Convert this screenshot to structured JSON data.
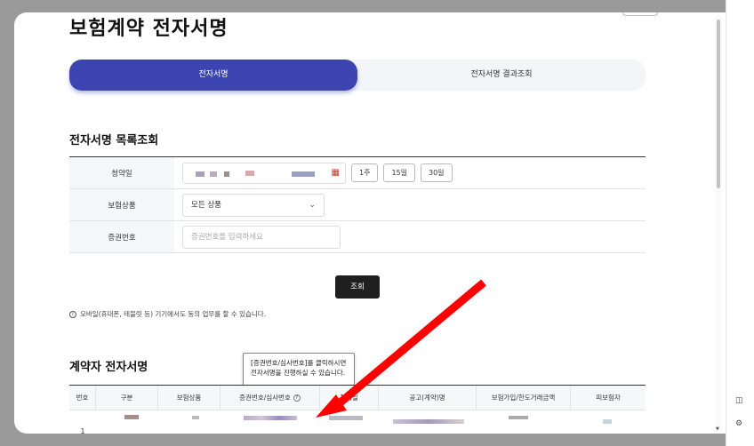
{
  "page": {
    "title": "보험계약 전자서명"
  },
  "tabs": [
    {
      "label": "전자서명",
      "active": true
    },
    {
      "label": "전자서명 결과조회",
      "active": false
    }
  ],
  "search_section": {
    "title": "전자서명 목록조회",
    "rows": {
      "date": {
        "label": "청약일",
        "period_buttons": [
          "1주",
          "15일",
          "30일"
        ]
      },
      "product": {
        "label": "보험상품",
        "selected": "모든 상품"
      },
      "policy": {
        "label": "증권번호",
        "placeholder": "증권번호를 입력하세요"
      }
    },
    "search_button": "조회",
    "notice": "모바일(휴대폰, 테블릿 등) 기기에서도 동의 업무를 할 수 있습니다."
  },
  "result_section": {
    "title": "계약자 전자서명",
    "tooltip_line1": "[증권번호/심사번호]를 클릭하시면",
    "tooltip_line2": "전자서명을 진행하실 수 있습니다.",
    "columns": [
      "번호",
      "구분",
      "보험상품",
      "증권번호/심사번호",
      "청약일",
      "공고(계약)명",
      "보험가입/한도거래금액",
      "피보험자"
    ],
    "rows": [
      {
        "no": "1"
      }
    ]
  },
  "colors": {
    "accent": "#3b44b0",
    "annotation_arrow": "#ff0000"
  },
  "icons": {
    "calendar": "calendar-icon",
    "info": "info-icon",
    "help": "question-icon",
    "chevron": "chevron-down-icon"
  }
}
